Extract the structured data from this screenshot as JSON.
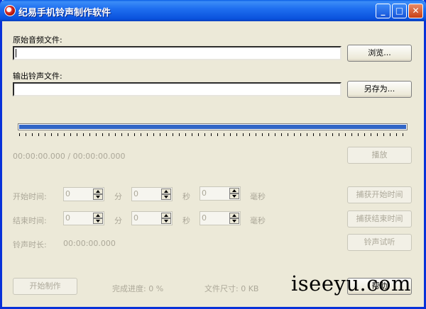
{
  "window": {
    "title": "纪易手机铃声制作软件",
    "minimize": "_",
    "maximize": "□",
    "close": "✕"
  },
  "source": {
    "label": "原始音频文件:",
    "value": "",
    "browse_label": "浏览..."
  },
  "output": {
    "label": "输出铃声文件:",
    "value": "",
    "saveas_label": "另存为..."
  },
  "player": {
    "progress": 1.0,
    "time_readout": "00:00:00.000 / 00:00:00.000",
    "play_label": "播放"
  },
  "start": {
    "label": "开始时间:",
    "minutes": "0",
    "seconds": "0",
    "milliseconds": "0",
    "unit_min": "分",
    "unit_sec": "秒",
    "unit_ms": "毫秒",
    "capture_label": "捕获开始时间"
  },
  "end": {
    "label": "结束时间:",
    "minutes": "0",
    "seconds": "0",
    "milliseconds": "0",
    "unit_min": "分",
    "unit_sec": "秒",
    "unit_ms": "毫秒",
    "capture_label": "捕获结束时间"
  },
  "duration": {
    "label": "铃声时长:",
    "value": "00:00:00.000",
    "preview_label": "铃声试听"
  },
  "footer": {
    "start_label": "开始制作",
    "progress_text": "完成进度: 0 %",
    "size_text": "文件尺寸: 0 KB",
    "help_label": "帮助"
  },
  "watermark": "iseeyu.com",
  "colors": {
    "title_bar": "#0a52dd",
    "slider_fill": "#3165c6",
    "disabled_text": "#aca899",
    "background": "#ece9d8"
  }
}
